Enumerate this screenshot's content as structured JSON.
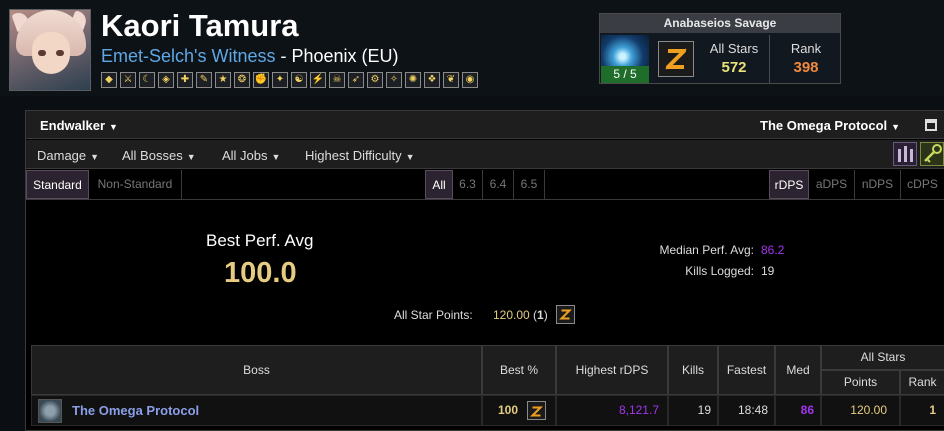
{
  "character": {
    "name": "Kaori Tamura",
    "title": "Emet-Selch's Witness",
    "server_separator": " - ",
    "server": "Phoenix (EU)"
  },
  "jobs": [
    "PLD",
    "WAR",
    "DRK",
    "GNB",
    "WHM",
    "SCH",
    "AST",
    "SGE",
    "MNK",
    "DRG",
    "NIN",
    "SAM",
    "RPR",
    "BRD",
    "MCH",
    "DNC",
    "BLM",
    "SMN",
    "RDM",
    "BLU"
  ],
  "tier": {
    "name": "Anabaseios Savage",
    "progress": "5 / 5",
    "all_stars_label": "All Stars",
    "all_stars_value": "572",
    "rank_label": "Rank",
    "rank_value": "398"
  },
  "zone_bar": {
    "expansion": "Endwalker",
    "zone": "The Omega Protocol"
  },
  "filters": {
    "metric": "Damage",
    "bosses": "All Bosses",
    "jobs": "All Jobs",
    "difficulty": "Highest Difficulty"
  },
  "toggles": {
    "standard": "Standard",
    "nonstandard": "Non-Standard",
    "patches": [
      "All",
      "6.3",
      "6.4",
      "6.5"
    ],
    "metrics": [
      "rDPS",
      "aDPS",
      "nDPS",
      "cDPS"
    ]
  },
  "summary": {
    "best_perf_label": "Best Perf. Avg",
    "best_perf_value": "100.0",
    "median_label": "Median Perf. Avg:",
    "median_value": "86.2",
    "kills_label": "Kills Logged:",
    "kills_value": "19",
    "asp_label": "All Star Points:",
    "asp_value": "120.00",
    "asp_count_open": " (",
    "asp_count": "1",
    "asp_count_close": ")"
  },
  "table": {
    "headers": {
      "boss": "Boss",
      "best": "Best %",
      "highest": "Highest rDPS",
      "kills": "Kills",
      "fastest": "Fastest",
      "med": "Med",
      "all_stars": "All Stars",
      "points": "Points",
      "rank": "Rank"
    },
    "row": {
      "boss": "The Omega Protocol",
      "best": "100",
      "highest": "8,121.7",
      "kills": "19",
      "fastest": "18:48",
      "med": "86",
      "points": "120.00",
      "rank": "1"
    }
  },
  "colors": {
    "legendary": "#e5cc80",
    "epic": "#a335ee",
    "boss_link": "#8b9ee8",
    "rank_orange": "#f0883e",
    "stars_yellow": "#e8e27a",
    "title_blue": "#5fa8e6"
  }
}
